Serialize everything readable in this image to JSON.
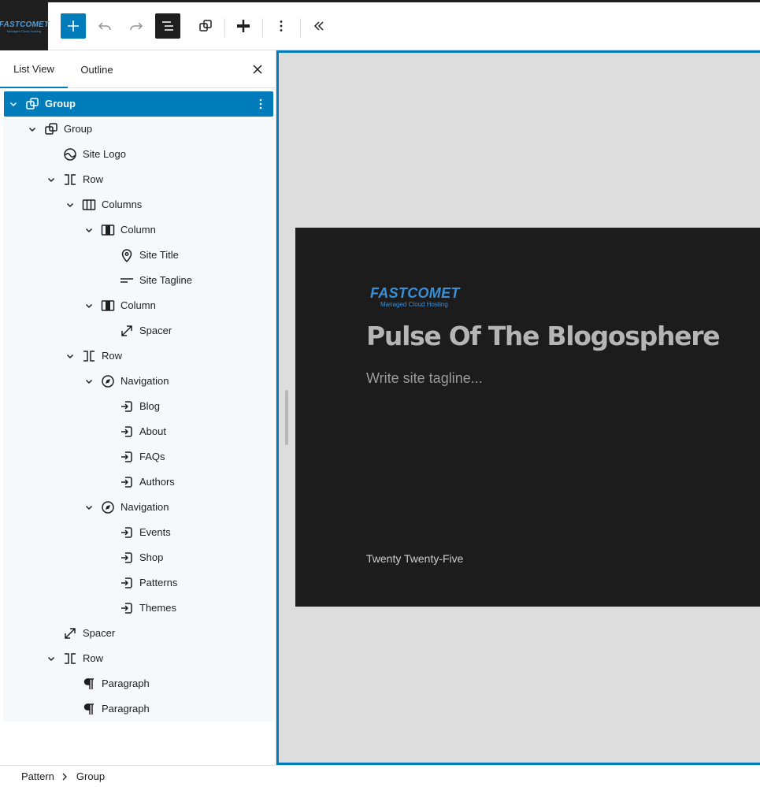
{
  "site_badge": {
    "brand": "FASTCOMET",
    "sub": "Managed Cloud Hosting"
  },
  "toolbar": {
    "add": "block-inserter",
    "undo": "undo",
    "redo": "redo",
    "document_overview": "document-overview",
    "patterns": "patterns",
    "tools": "tools",
    "options": "options",
    "collapse": "collapse"
  },
  "sidebar": {
    "tabs": [
      {
        "label": "List View",
        "active": true
      },
      {
        "label": "Outline",
        "active": false
      }
    ],
    "items": [
      {
        "label": "Group",
        "level": 0,
        "icon": "group-icon",
        "expanded": true,
        "selected": true
      },
      {
        "label": "Group",
        "level": 1,
        "icon": "group-icon",
        "expanded": true
      },
      {
        "label": "Site Logo",
        "level": 2,
        "icon": "site-logo-icon"
      },
      {
        "label": "Row",
        "level": 2,
        "icon": "row-icon",
        "expanded": true
      },
      {
        "label": "Columns",
        "level": 3,
        "icon": "columns-icon",
        "expanded": true
      },
      {
        "label": "Column",
        "level": 4,
        "icon": "column-icon",
        "expanded": true
      },
      {
        "label": "Site Title",
        "level": 5,
        "icon": "map-marker-icon"
      },
      {
        "label": "Site Tagline",
        "level": 5,
        "icon": "tagline-icon"
      },
      {
        "label": "Column",
        "level": 4,
        "icon": "column-icon",
        "expanded": true
      },
      {
        "label": "Spacer",
        "level": 5,
        "icon": "spacer-icon"
      },
      {
        "label": "Row",
        "level": 3,
        "icon": "row-icon",
        "expanded": true
      },
      {
        "label": "Navigation",
        "level": 4,
        "icon": "navigation-icon",
        "expanded": true
      },
      {
        "label": "Blog",
        "level": 5,
        "icon": "page-link-icon"
      },
      {
        "label": "About",
        "level": 5,
        "icon": "page-link-icon"
      },
      {
        "label": "FAQs",
        "level": 5,
        "icon": "page-link-icon"
      },
      {
        "label": "Authors",
        "level": 5,
        "icon": "page-link-icon"
      },
      {
        "label": "Navigation",
        "level": 4,
        "icon": "navigation-icon",
        "expanded": true
      },
      {
        "label": "Events",
        "level": 5,
        "icon": "page-link-icon"
      },
      {
        "label": "Shop",
        "level": 5,
        "icon": "page-link-icon"
      },
      {
        "label": "Patterns",
        "level": 5,
        "icon": "page-link-icon"
      },
      {
        "label": "Themes",
        "level": 5,
        "icon": "page-link-icon"
      },
      {
        "label": "Spacer",
        "level": 2,
        "icon": "spacer-icon"
      },
      {
        "label": "Row",
        "level": 2,
        "icon": "row-icon",
        "expanded": true
      },
      {
        "label": "Paragraph",
        "level": 3,
        "icon": "paragraph-icon"
      },
      {
        "label": "Paragraph",
        "level": 3,
        "icon": "paragraph-icon"
      }
    ]
  },
  "canvas": {
    "logo": {
      "brand": "FASTCOMET",
      "sub": "Managed Cloud Hosting"
    },
    "site_title": "Pulse Of The Blogosphere",
    "tagline": "Write site tagline...",
    "footer_text": "Twenty Twenty-Five"
  },
  "breadcrumb": [
    "Pattern",
    "Group"
  ],
  "colors": {
    "accent": "#007cba",
    "canvas_bg": "#dddddd",
    "header_bg": "#1c1c1c",
    "tree_bg": "#f5f9fc"
  }
}
